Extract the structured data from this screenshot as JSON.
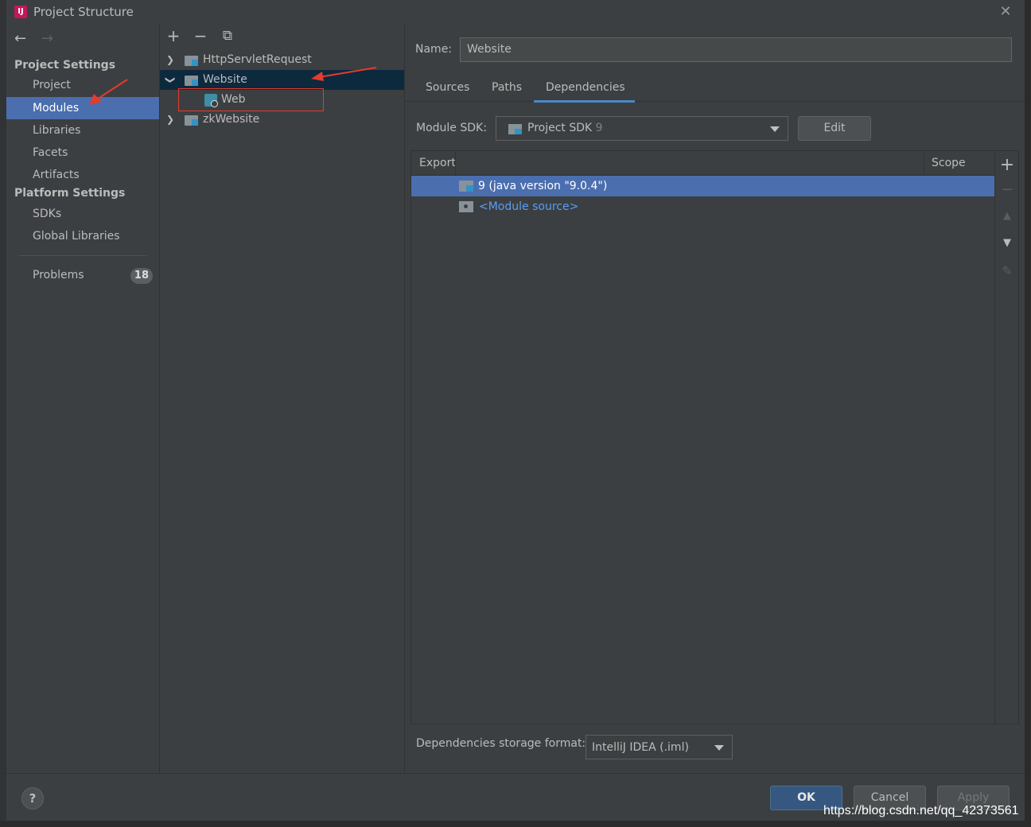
{
  "window": {
    "title": "Project Structure",
    "icon_text": "IJ"
  },
  "nav": {
    "back_icon": "arrow-left-icon",
    "forward_icon": "arrow-right-icon",
    "group_project": "Project Settings",
    "group_platform": "Platform Settings",
    "items": [
      {
        "label": "Project"
      },
      {
        "label": "Modules"
      },
      {
        "label": "Libraries"
      },
      {
        "label": "Facets"
      },
      {
        "label": "Artifacts"
      },
      {
        "label": "SDKs"
      },
      {
        "label": "Global Libraries"
      },
      {
        "label": "Problems",
        "badge": "18"
      }
    ],
    "selected": "Modules"
  },
  "tree": {
    "toolbar": {
      "add": "+",
      "remove": "−",
      "copy": "⧉"
    },
    "rows": [
      {
        "label": "HttpServletRequest",
        "expanded": false
      },
      {
        "label": "Website",
        "expanded": true,
        "selected": true
      },
      {
        "label": "Web",
        "child": true
      },
      {
        "label": "zkWebsite",
        "expanded": false
      }
    ]
  },
  "module": {
    "name_label": "Name:",
    "name_value": "Website",
    "tabs": [
      "Sources",
      "Paths",
      "Dependencies"
    ],
    "active_tab": "Dependencies",
    "sdk_label": "Module SDK:",
    "sdk_value": "Project SDK",
    "sdk_version": "9",
    "edit_button": "Edit",
    "table": {
      "headers": [
        "Export",
        "Scope"
      ],
      "rows": [
        {
          "label": "9 (java version \"9.0.4\")",
          "selected": true
        },
        {
          "label": "<Module source>",
          "link": true
        }
      ]
    },
    "storage_label": "Dependencies storage format:",
    "storage_value": "IntelliJ IDEA (.iml)"
  },
  "footer": {
    "help": "?",
    "ok": "OK",
    "cancel": "Cancel",
    "apply": "Apply"
  },
  "watermark": "https://blog.csdn.net/qq_42373561",
  "colors": {
    "selection": "#4b6eaf",
    "tree_selection": "#0d293e",
    "annotation_red": "#e33b2e",
    "link": "#589df6"
  }
}
